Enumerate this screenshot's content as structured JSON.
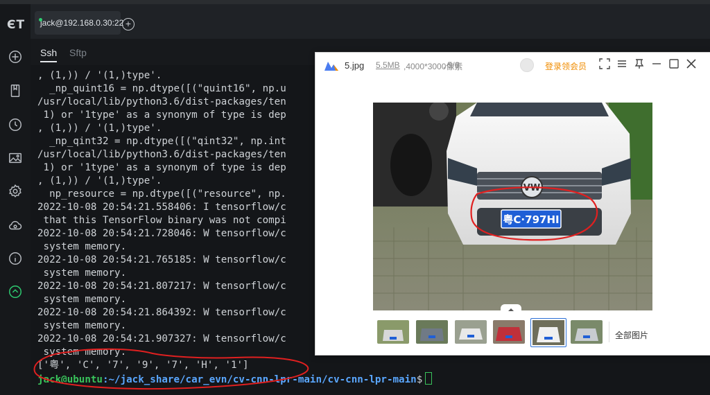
{
  "app": {
    "logo_text": "ЄT",
    "session_tab": "jack@192.168.0.30:22",
    "subtabs": {
      "ssh": "Ssh",
      "sftp": "Sftp"
    }
  },
  "terminal": {
    "lines": [
      ", (1,)) / '(1,)type'.",
      "  _np_quint16 = np.dtype([(\"quint16\", np.u",
      "/usr/local/lib/python3.6/dist-packages/ten",
      " 1) or '1type' as a synonym of type is dep",
      ", (1,)) / '(1,)type'.",
      "  _np_qint32 = np.dtype([(\"qint32\", np.int",
      "/usr/local/lib/python3.6/dist-packages/ten",
      " 1) or '1type' as a synonym of type is dep",
      ", (1,)) / '(1,)type'.",
      "  np_resource = np.dtype([(\"resource\", np.",
      "2022-10-08 20:54:21.558406: I tensorflow/c",
      " that this TensorFlow binary was not compi",
      "2022-10-08 20:54:21.728046: W tensorflow/c",
      " system memory.",
      "2022-10-08 20:54:21.765185: W tensorflow/c",
      " system memory.",
      "2022-10-08 20:54:21.807217: W tensorflow/c",
      " system memory.",
      "2022-10-08 20:54:21.864392: W tensorflow/c",
      " system memory.",
      "2022-10-08 20:54:21.907327: W tensorflow/c",
      " system memory.",
      "['粤', 'C', '7', '9', '7', 'H', '1']"
    ],
    "prompt_user": "jack@ubuntu",
    "prompt_path": ":~/jack_share/car_evn/cv-cnn-lpr-main/cv-cnn-lpr-main",
    "prompt_symbol": "$"
  },
  "viewer": {
    "filename": "5.jpg",
    "file_size": "5.5MB",
    "resolution": ",4000*3000像素",
    "position": ", 5/6",
    "vip_label": "登录领会员",
    "plate_text": "粤C·797HI",
    "brand_badge": "VW",
    "all_pictures": "全部图片",
    "thumbnails": [
      {
        "name": "thumb-1",
        "body": "#d8d8d8",
        "bg": "#8a9a6a",
        "selected": false
      },
      {
        "name": "thumb-2",
        "body": "#707a86",
        "bg": "#6a7a5a",
        "selected": false
      },
      {
        "name": "thumb-3",
        "body": "#e8e8e8",
        "bg": "#9aa090",
        "selected": false
      },
      {
        "name": "thumb-4",
        "body": "#c0303a",
        "bg": "#8a7a6a",
        "selected": false
      },
      {
        "name": "thumb-5",
        "body": "#f0f0f0",
        "bg": "#6e6e5a",
        "selected": true
      },
      {
        "name": "thumb-6",
        "body": "#c8ccd0",
        "bg": "#7a8a6a",
        "selected": false
      }
    ]
  },
  "colors": {
    "accent_red": "#e02020",
    "prompt_green": "#39c35b",
    "prompt_blue": "#5aa7ff",
    "vip_orange": "#f08c00",
    "selection_blue": "#2b6fd6"
  }
}
